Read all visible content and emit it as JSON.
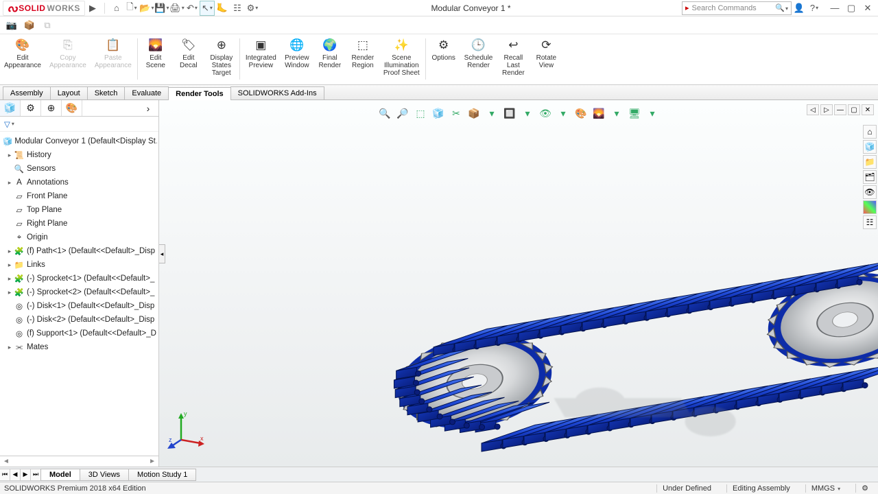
{
  "app": {
    "brand1": "SOLID",
    "brand2": "WORKS",
    "document_title": "Modular Conveyor 1 *"
  },
  "search": {
    "placeholder": "Search Commands"
  },
  "ribbon": {
    "groups": [
      {
        "id": "edit-appearance",
        "label": "Edit\nAppearance",
        "icon": "🎨",
        "enabled": true
      },
      {
        "id": "copy-appearance",
        "label": "Copy\nAppearance",
        "icon": "⎘",
        "enabled": false
      },
      {
        "id": "paste-appearance",
        "label": "Paste\nAppearance",
        "icon": "📋",
        "enabled": false
      },
      {
        "id": "edit-scene",
        "label": "Edit\nScene",
        "icon": "🌄",
        "enabled": true
      },
      {
        "id": "edit-decal",
        "label": "Edit\nDecal",
        "icon": "🏷",
        "enabled": true
      },
      {
        "id": "display-states-target",
        "label": "Display\nStates\nTarget",
        "icon": "⊕",
        "enabled": true
      },
      {
        "id": "integrated-preview",
        "label": "Integrated\nPreview",
        "icon": "▣",
        "enabled": true
      },
      {
        "id": "preview-window",
        "label": "Preview\nWindow",
        "icon": "🌐",
        "enabled": true
      },
      {
        "id": "final-render",
        "label": "Final\nRender",
        "icon": "🌍",
        "enabled": true
      },
      {
        "id": "render-region",
        "label": "Render\nRegion",
        "icon": "⬚",
        "enabled": true
      },
      {
        "id": "scene-illum",
        "label": "Scene\nIllumination\nProof Sheet",
        "icon": "✨",
        "enabled": true
      },
      {
        "id": "options",
        "label": "Options",
        "icon": "⚙",
        "enabled": true
      },
      {
        "id": "schedule-render",
        "label": "Schedule\nRender",
        "icon": "🕒",
        "enabled": true
      },
      {
        "id": "recall-last-render",
        "label": "Recall\nLast\nRender",
        "icon": "↩",
        "enabled": true
      },
      {
        "id": "rotate-view",
        "label": "Rotate\nView",
        "icon": "⟳",
        "enabled": true
      }
    ]
  },
  "tabs": {
    "items": [
      "Assembly",
      "Layout",
      "Sketch",
      "Evaluate",
      "Render Tools",
      "SOLIDWORKS Add-Ins"
    ],
    "active": 4
  },
  "tree": {
    "root": "Modular Conveyor 1  (Default<Display St…",
    "items": [
      {
        "icon": "📜",
        "label": "History",
        "tw": "▸"
      },
      {
        "icon": "🔍",
        "label": "Sensors",
        "tw": ""
      },
      {
        "icon": "A",
        "label": "Annotations",
        "tw": "▸"
      },
      {
        "icon": "▱",
        "label": "Front Plane",
        "tw": ""
      },
      {
        "icon": "▱",
        "label": "Top Plane",
        "tw": ""
      },
      {
        "icon": "▱",
        "label": "Right Plane",
        "tw": ""
      },
      {
        "icon": "⌖",
        "label": "Origin",
        "tw": ""
      },
      {
        "icon": "🧩",
        "label": "(f) Path<1> (Default<<Default>_Disp",
        "tw": "▸"
      },
      {
        "icon": "📁",
        "label": "Links",
        "tw": "▸"
      },
      {
        "icon": "🧩",
        "label": "(-) Sprocket<1> (Default<<Default>_",
        "tw": "▸"
      },
      {
        "icon": "🧩",
        "label": "(-) Sprocket<2> (Default<<Default>_",
        "tw": "▸"
      },
      {
        "icon": "◎",
        "label": "(-) Disk<1> (Default<<Default>_Disp",
        "tw": ""
      },
      {
        "icon": "◎",
        "label": "(-) Disk<2> (Default<<Default>_Disp",
        "tw": ""
      },
      {
        "icon": "◎",
        "label": "(f) Support<1> (Default<<Default>_D",
        "tw": ""
      },
      {
        "icon": "⫘",
        "label": "Mates",
        "tw": "▸"
      }
    ]
  },
  "heads_up": [
    "🔍",
    "🔎",
    "⬚",
    "🧊",
    "✂",
    "📦",
    "▾",
    "🔲",
    "▾",
    "👁",
    "▾",
    "🎨",
    "🌄",
    "▾",
    "🖥",
    "▾"
  ],
  "bottom_tabs": {
    "items": [
      "Model",
      "3D Views",
      "Motion Study 1"
    ],
    "active": 0
  },
  "status": {
    "left": "SOLIDWORKS Premium 2018 x64 Edition",
    "defined": "Under Defined",
    "mode": "Editing Assembly",
    "units": "MMGS"
  },
  "triad": {
    "x": "x",
    "y": "y",
    "z": "z"
  }
}
